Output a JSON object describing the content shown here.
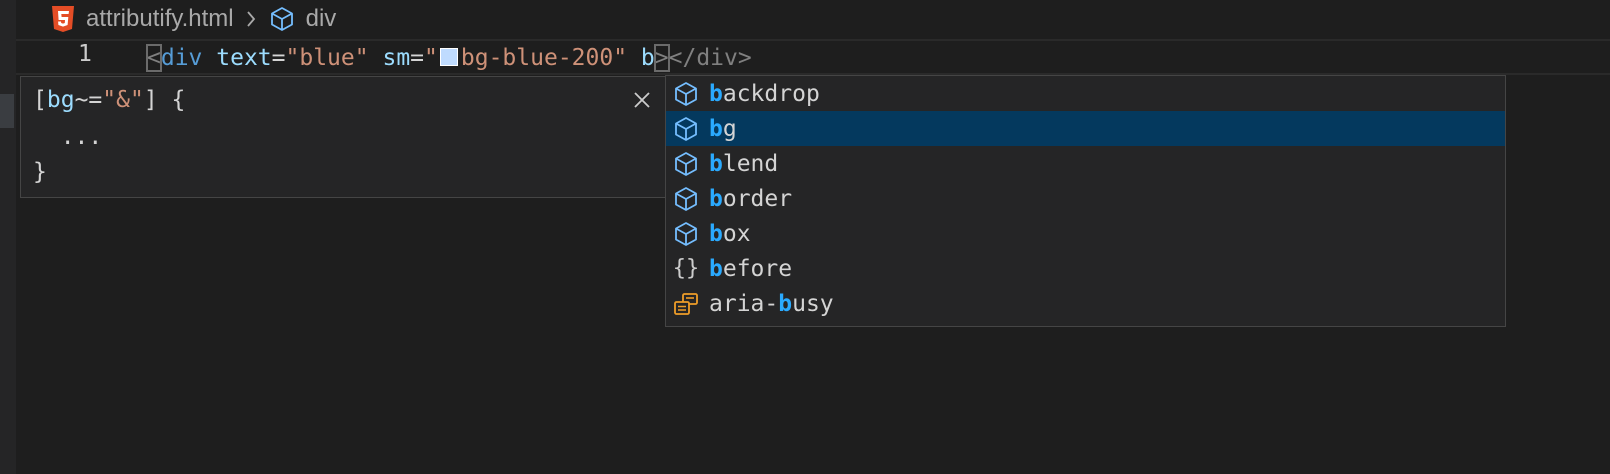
{
  "breadcrumb": {
    "file": "attributify.html",
    "element": "div"
  },
  "editor": {
    "line_number": "1",
    "tokens": {
      "open_lt": "<",
      "tag": "div",
      "attr1_name": "text",
      "eq": "=",
      "attr1_value": "\"blue\"",
      "attr2_name": "sm",
      "attr2_quote": "\"",
      "attr2_value": "bg-blue-200\"",
      "typed": "b",
      "open_gt": ">",
      "close_tag": "</div>"
    },
    "swatch_color": "#bfdbfe"
  },
  "details": {
    "line1_bracket_open": "[",
    "line1_attr": "bg",
    "line1_op": "~=",
    "line1_value": "\"&\"",
    "line1_rest": "] {",
    "line2": "  ...",
    "line3": "}"
  },
  "suggestions": {
    "items": [
      {
        "icon": "cube-icon",
        "match": "b",
        "rest": "ackdrop",
        "prefix": ""
      },
      {
        "icon": "cube-icon",
        "match": "b",
        "rest": "g",
        "prefix": "",
        "selected": true
      },
      {
        "icon": "cube-icon",
        "match": "b",
        "rest": "lend",
        "prefix": ""
      },
      {
        "icon": "cube-icon",
        "match": "b",
        "rest": "order",
        "prefix": ""
      },
      {
        "icon": "cube-icon",
        "match": "b",
        "rest": "ox",
        "prefix": ""
      },
      {
        "icon": "braces-icon",
        "match": "b",
        "rest": "efore",
        "prefix": "",
        "glyph": "{}"
      },
      {
        "icon": "property-icon",
        "match": "b",
        "rest": "usy",
        "prefix": "aria-"
      }
    ]
  },
  "colors": {
    "background": "#1e1e1e",
    "panel": "#252526",
    "selected_row": "#04395e",
    "match_highlight": "#2aaaff",
    "cube_icon": "#75beff",
    "property_icon": "#ee9d28",
    "html_icon": "#e44d26"
  }
}
